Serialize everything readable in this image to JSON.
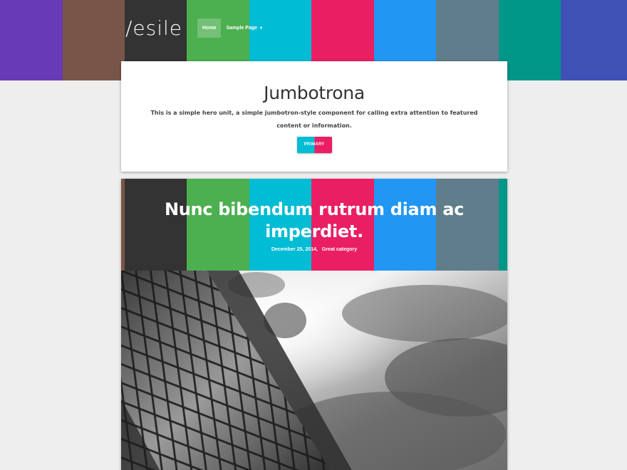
{
  "header": {
    "logo_text": "/esile",
    "band_colors": [
      "#673ab7",
      "#795548",
      "#333333",
      "#4caf50",
      "#00bcd4",
      "#e91e63",
      "#2196f3",
      "#607d8b",
      "#009688",
      "#3f51b5"
    ],
    "nav": [
      {
        "label": "Home",
        "active": true
      },
      {
        "label": "Sample Page",
        "has_dropdown": true,
        "caret": "▾"
      }
    ]
  },
  "jumbotron": {
    "title": "Jumbotrona",
    "text": "This is a simple hero unit, a simple jumbotron-style component for calling extra attention to featured content or information.",
    "button_label": "PRIMARY",
    "button_colors": [
      "#00bcd4",
      "#e91e63"
    ]
  },
  "post": {
    "band_colors": [
      "#795548",
      "#333333",
      "#4caf50",
      "#00bcd4",
      "#e91e63",
      "#2196f3",
      "#607d8b",
      "#009688"
    ],
    "title": "Nunc bibendum rutrum diam ac imperdiet.",
    "date": "December 25, 2014,",
    "category": "Great category",
    "image": "black-and-white-skyscraper-with-clouds"
  }
}
